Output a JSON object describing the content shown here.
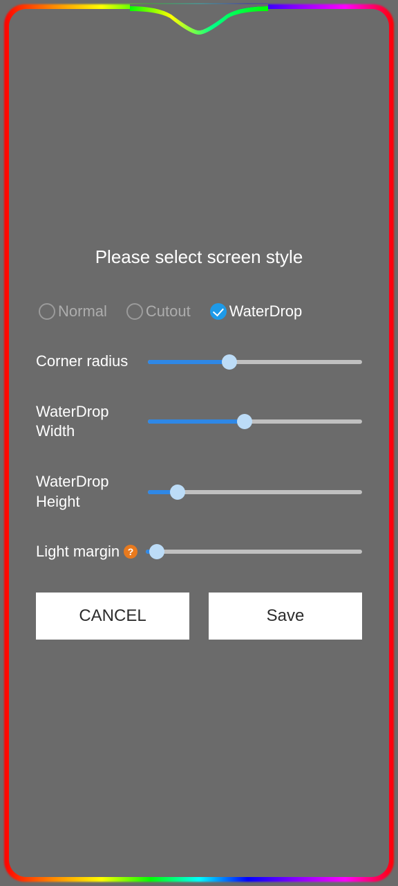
{
  "title": "Please select screen style",
  "styles": {
    "normal": {
      "label": "Normal",
      "selected": false
    },
    "cutout": {
      "label": "Cutout",
      "selected": false
    },
    "waterdrop": {
      "label": "WaterDrop",
      "selected": true
    }
  },
  "sliders": {
    "corner_radius": {
      "label": "Corner radius",
      "value": 38
    },
    "waterdrop_width": {
      "label": "WaterDrop Width",
      "value": 45
    },
    "waterdrop_height": {
      "label": "WaterDrop Height",
      "value": 14
    },
    "light_margin": {
      "label": "Light margin",
      "value": 5
    }
  },
  "buttons": {
    "cancel": "CANCEL",
    "save": "Save"
  }
}
